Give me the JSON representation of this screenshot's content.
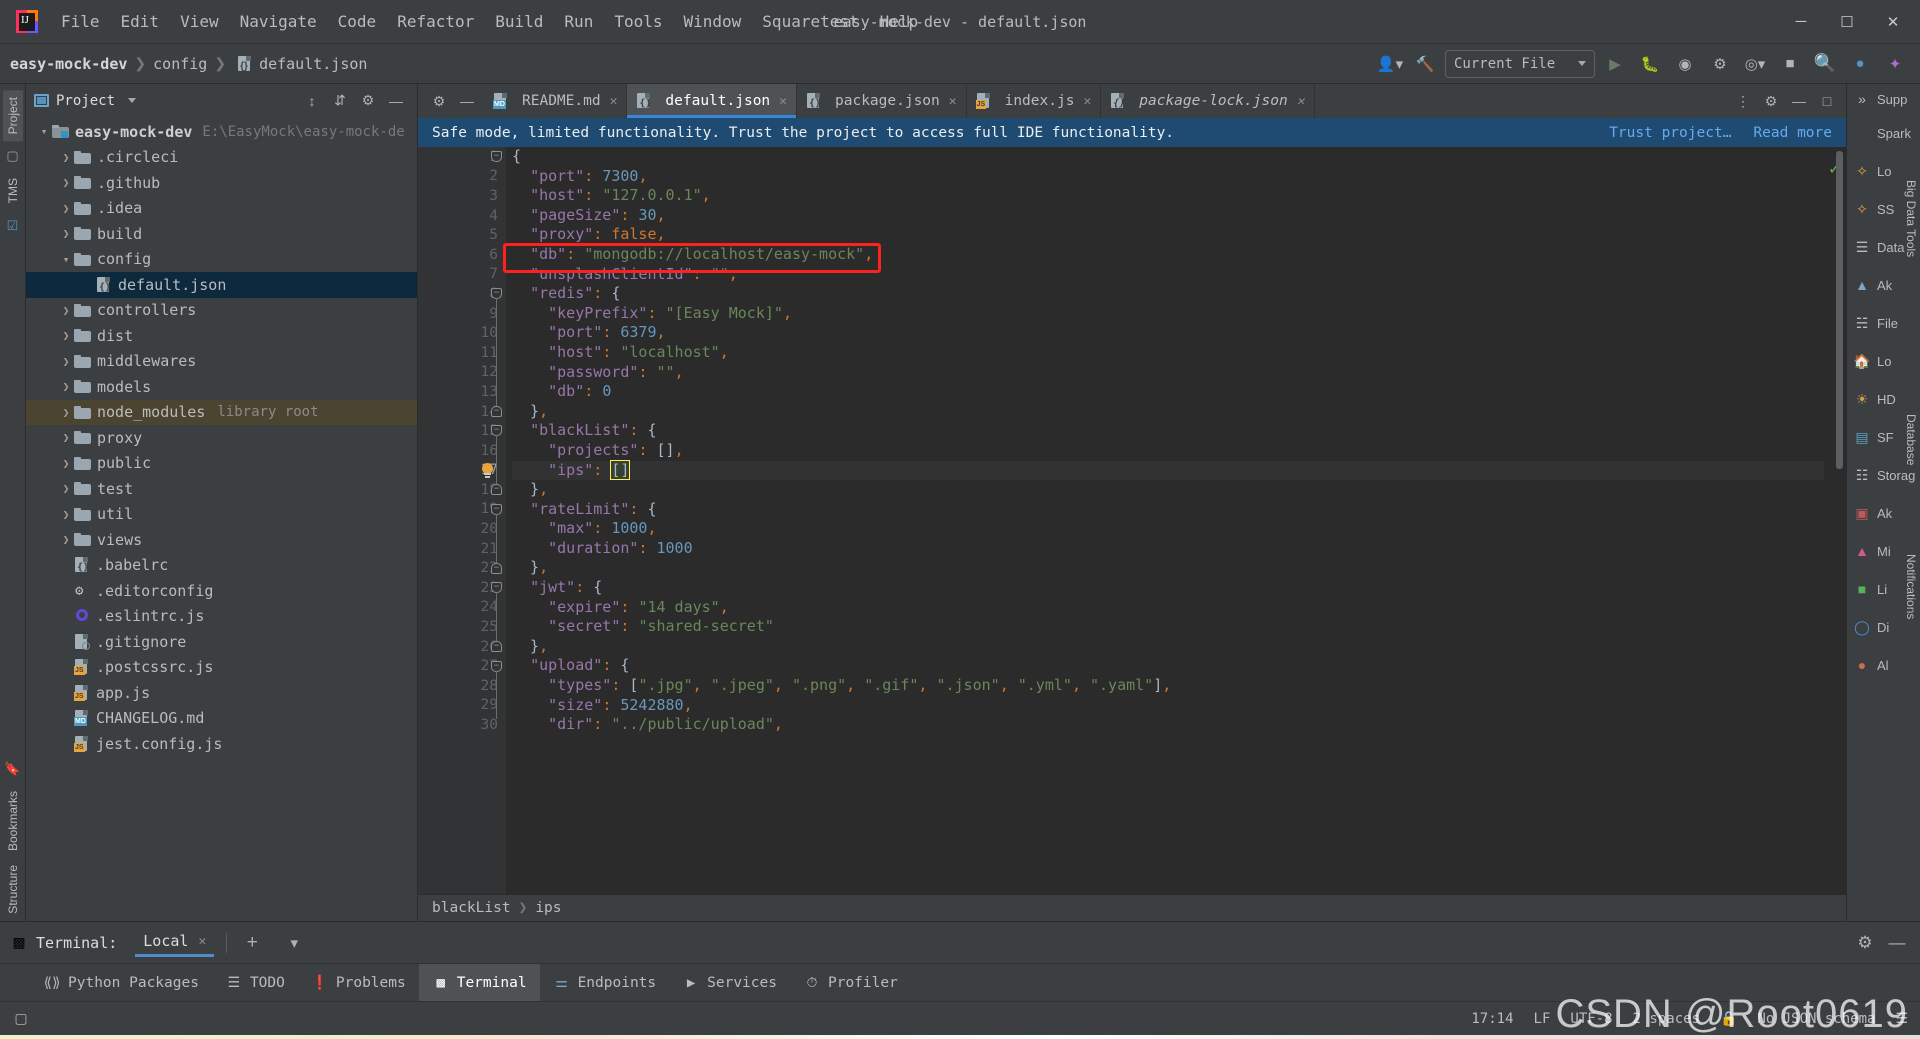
{
  "window": {
    "title": "easy-mock-dev - default.json",
    "minimize": "─",
    "maximize": "☐",
    "close": "✕"
  },
  "menu": [
    {
      "label": "File"
    },
    {
      "label": "Edit"
    },
    {
      "label": "View"
    },
    {
      "label": "Navigate"
    },
    {
      "label": "Code"
    },
    {
      "label": "Refactor"
    },
    {
      "label": "Build"
    },
    {
      "label": "Run"
    },
    {
      "label": "Tools"
    },
    {
      "label": "Window"
    },
    {
      "label": "Squaretest"
    },
    {
      "label": "Help"
    }
  ],
  "navbar": {
    "crumbs": [
      "easy-mock-dev",
      "config",
      "default.json"
    ],
    "run_config": "Current File",
    "icons": [
      "user-icon",
      "hammer-icon",
      "run-icon",
      "debug-icon",
      "coverage-icon",
      "profile-icon",
      "more-run-icon",
      "stop-icon",
      "search-icon",
      "updates-icon",
      "ai-icon"
    ]
  },
  "left_stripe": {
    "tabs": [
      "Project",
      "TMS",
      "Bookmarks",
      "Structure"
    ]
  },
  "project_panel": {
    "title": "Project",
    "root": {
      "name": "easy-mock-dev",
      "path": "E:\\EasyMock\\easy-mock-de"
    },
    "tree": [
      {
        "name": ".circleci",
        "type": "folder",
        "depth": 1,
        "expandable": true
      },
      {
        "name": ".github",
        "type": "folder",
        "depth": 1,
        "expandable": true
      },
      {
        "name": ".idea",
        "type": "folder",
        "depth": 1,
        "expandable": true
      },
      {
        "name": "build",
        "type": "folder",
        "depth": 1,
        "expandable": true
      },
      {
        "name": "config",
        "type": "folder",
        "depth": 1,
        "expandable": true,
        "expanded": true
      },
      {
        "name": "default.json",
        "type": "json",
        "depth": 2,
        "selected": true
      },
      {
        "name": "controllers",
        "type": "folder",
        "depth": 1,
        "expandable": true
      },
      {
        "name": "dist",
        "type": "folder",
        "depth": 1,
        "expandable": true
      },
      {
        "name": "middlewares",
        "type": "folder",
        "depth": 1,
        "expandable": true
      },
      {
        "name": "models",
        "type": "folder",
        "depth": 1,
        "expandable": true
      },
      {
        "name": "node_modules",
        "type": "folder",
        "depth": 1,
        "expandable": true,
        "label": "library root",
        "highlighted": true
      },
      {
        "name": "proxy",
        "type": "folder",
        "depth": 1,
        "expandable": true
      },
      {
        "name": "public",
        "type": "folder",
        "depth": 1,
        "expandable": true
      },
      {
        "name": "test",
        "type": "folder",
        "depth": 1,
        "expandable": true
      },
      {
        "name": "util",
        "type": "folder",
        "depth": 1,
        "expandable": true
      },
      {
        "name": "views",
        "type": "folder",
        "depth": 1,
        "expandable": true
      },
      {
        "name": ".babelrc",
        "type": "json",
        "depth": 1
      },
      {
        "name": ".editorconfig",
        "type": "gear",
        "depth": 1
      },
      {
        "name": ".eslintrc.js",
        "type": "eslint",
        "depth": 1
      },
      {
        "name": ".gitignore",
        "type": "git",
        "depth": 1
      },
      {
        "name": ".postcssrc.js",
        "type": "js",
        "depth": 1
      },
      {
        "name": "app.js",
        "type": "js",
        "depth": 1
      },
      {
        "name": "CHANGELOG.md",
        "type": "md",
        "depth": 1
      },
      {
        "name": "jest.config.js",
        "type": "js",
        "depth": 1
      }
    ]
  },
  "editor": {
    "tabs": [
      {
        "label": "README.md",
        "icon": "md",
        "active": false,
        "italic": false
      },
      {
        "label": "default.json",
        "icon": "json",
        "active": true,
        "italic": false
      },
      {
        "label": "package.json",
        "icon": "json",
        "active": false,
        "italic": false
      },
      {
        "label": "index.js",
        "icon": "js",
        "active": false,
        "italic": false
      },
      {
        "label": "package-lock.json",
        "icon": "json",
        "active": false,
        "italic": true
      }
    ],
    "notification": {
      "message": "Safe mode, limited functionality. Trust the project to access full IDE functionality.",
      "action_trust": "Trust project…",
      "action_read": "Read more"
    },
    "lines": [
      {
        "n": 1,
        "text": "{",
        "fold": "open"
      },
      {
        "n": 2,
        "text": "  \"port\": 7300,"
      },
      {
        "n": 3,
        "text": "  \"host\": \"127.0.0.1\","
      },
      {
        "n": 4,
        "text": "  \"pageSize\": 30,"
      },
      {
        "n": 5,
        "text": "  \"proxy\": false,"
      },
      {
        "n": 6,
        "text": "  \"db\": \"mongodb://localhost/easy-mock\","
      },
      {
        "n": 7,
        "text": "  \"unsplashClientId\": \"\","
      },
      {
        "n": 8,
        "text": "  \"redis\": {",
        "fold": "open"
      },
      {
        "n": 9,
        "text": "    \"keyPrefix\": \"[Easy Mock]\","
      },
      {
        "n": 10,
        "text": "    \"port\": 6379,"
      },
      {
        "n": 11,
        "text": "    \"host\": \"localhost\","
      },
      {
        "n": 12,
        "text": "    \"password\": \"\","
      },
      {
        "n": 13,
        "text": "    \"db\": 0"
      },
      {
        "n": 14,
        "text": "  },",
        "fold": "close"
      },
      {
        "n": 15,
        "text": "  \"blackList\": {",
        "fold": "open"
      },
      {
        "n": 16,
        "text": "    \"projects\": [],"
      },
      {
        "n": 17,
        "text": "    \"ips\": []",
        "current": true,
        "bulb": true
      },
      {
        "n": 18,
        "text": "  },",
        "fold": "close"
      },
      {
        "n": 19,
        "text": "  \"rateLimit\": {",
        "fold": "open"
      },
      {
        "n": 20,
        "text": "    \"max\": 1000,"
      },
      {
        "n": 21,
        "text": "    \"duration\": 1000"
      },
      {
        "n": 22,
        "text": "  },",
        "fold": "close"
      },
      {
        "n": 23,
        "text": "  \"jwt\": {",
        "fold": "open"
      },
      {
        "n": 24,
        "text": "    \"expire\": \"14 days\","
      },
      {
        "n": 25,
        "text": "    \"secret\": \"shared-secret\""
      },
      {
        "n": 26,
        "text": "  },",
        "fold": "close"
      },
      {
        "n": 27,
        "text": "  \"upload\": {",
        "fold": "open"
      },
      {
        "n": 28,
        "text": "    \"types\": [\".jpg\", \".jpeg\", \".png\", \".gif\", \".json\", \".yml\", \".yaml\"],"
      },
      {
        "n": 29,
        "text": "    \"size\": 5242880,"
      },
      {
        "n": 30,
        "text": "    \"dir\": \"../public/upload\","
      }
    ],
    "annotation_box": {
      "color": "#ff2020",
      "target_line": 6,
      "target_text": "\"db\": \"mongodb://localhost/easy-mock\","
    },
    "breadcrumb": [
      "blackList",
      "ips"
    ],
    "inspection_status": "ok"
  },
  "right_stripe": {
    "items": [
      {
        "label": "Spark",
        "icon": "spark-icon"
      },
      {
        "label": "Lo",
        "icon": "leetcode-icon"
      },
      {
        "label": "SS",
        "icon": "ss-icon"
      },
      {
        "label": "Data",
        "icon": "database-icon"
      },
      {
        "label": "Ak",
        "icon": "ak-icon"
      },
      {
        "label": "File",
        "icon": "file-icon"
      },
      {
        "label": "Lo",
        "icon": "home-icon"
      },
      {
        "label": "HD",
        "icon": "hd-icon"
      },
      {
        "label": "SF",
        "icon": "sf-icon"
      },
      {
        "label": "Storag",
        "icon": "storage-icon"
      },
      {
        "label": "Ak",
        "icon": "ak2-icon"
      },
      {
        "label": "Mi",
        "icon": "mi-icon"
      },
      {
        "label": "Li",
        "icon": "li-icon"
      },
      {
        "label": "Di",
        "icon": "di-icon"
      },
      {
        "label": "Al",
        "icon": "al-icon"
      }
    ],
    "vtabs": [
      "Big Data Tools",
      "Database",
      "Notifications"
    ],
    "support_label": "Supp"
  },
  "terminal": {
    "label": "Terminal:",
    "tab": "Local",
    "close": "✕",
    "add": "+",
    "dropdown": "▾",
    "settings_icon": "gear-icon",
    "hide_icon": "minimize-icon"
  },
  "tool_window_bar": [
    {
      "label": "Python Packages",
      "icon": "python-packages-icon",
      "selected": false
    },
    {
      "label": "TODO",
      "icon": "todo-icon",
      "selected": false
    },
    {
      "label": "Problems",
      "icon": "problems-icon",
      "selected": false
    },
    {
      "label": "Terminal",
      "icon": "terminal-icon",
      "selected": true
    },
    {
      "label": "Endpoints",
      "icon": "endpoints-icon",
      "selected": false
    },
    {
      "label": "Services",
      "icon": "services-icon",
      "selected": false
    },
    {
      "label": "Profiler",
      "icon": "profiler-icon",
      "selected": false
    }
  ],
  "status_bar": {
    "time": "17:14",
    "line_separator": "LF",
    "encoding": "UTF-8",
    "indent": "2 spaces",
    "schema": "No JSON schema",
    "lock_icon": "lock-icon",
    "watermark": "CSDN @Root0619"
  }
}
